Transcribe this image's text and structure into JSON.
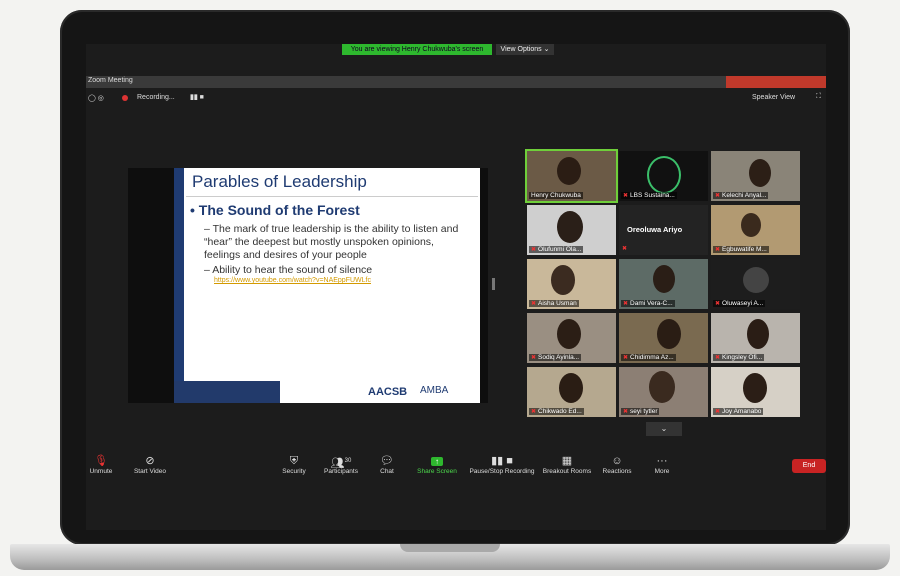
{
  "window": {
    "title": "Zoom Meeting",
    "share_banner": "You are viewing Henry Chukwuba's screen",
    "view_options": "View Options ⌄",
    "recording_label": "Recording...",
    "speaker_view": "Speaker View"
  },
  "slide": {
    "title": "Parables of Leadership",
    "heading": "The Sound of the Forest",
    "bullet1": "The mark of true leadership is the ability to listen and “hear” the deepest but mostly unspoken opinions, feelings and desires of your people",
    "bullet2": "Ability to hear the sound of silence",
    "link": "https://www.youtube.com/watch?v=NAEppFUWLfc",
    "footer_logo1": "AACSB",
    "footer_logo2": "AMBA"
  },
  "participants": [
    "Henry Chukwuba",
    "LBS Sustaina...",
    "Kelechi Anyal...",
    "Olufunmi Ola...",
    "Oreoluwa Ariyo",
    "Egbuwatife M...",
    "Aisha Usman",
    "Dami Vera-C...",
    "Oluwaseyi A...",
    "Sodiq Ayinla...",
    "Chidimma Az...",
    "Kingsley Ofi...",
    "Chikwado Ed...",
    "seyi tytler",
    "Joy Amanabo"
  ],
  "toolbar": {
    "unmute": "Unmute",
    "start_video": "Start Video",
    "security": "Security",
    "participants": "Participants",
    "participants_count": "30",
    "chat": "Chat",
    "share_screen": "Share Screen",
    "pause_recording": "Pause/Stop Recording",
    "breakout": "Breakout Rooms",
    "reactions": "Reactions",
    "more": "More",
    "end": "End"
  },
  "colors": {
    "share_green": "#2eb82e",
    "end_red": "#c82323",
    "slide_blue": "#1f3b72"
  }
}
